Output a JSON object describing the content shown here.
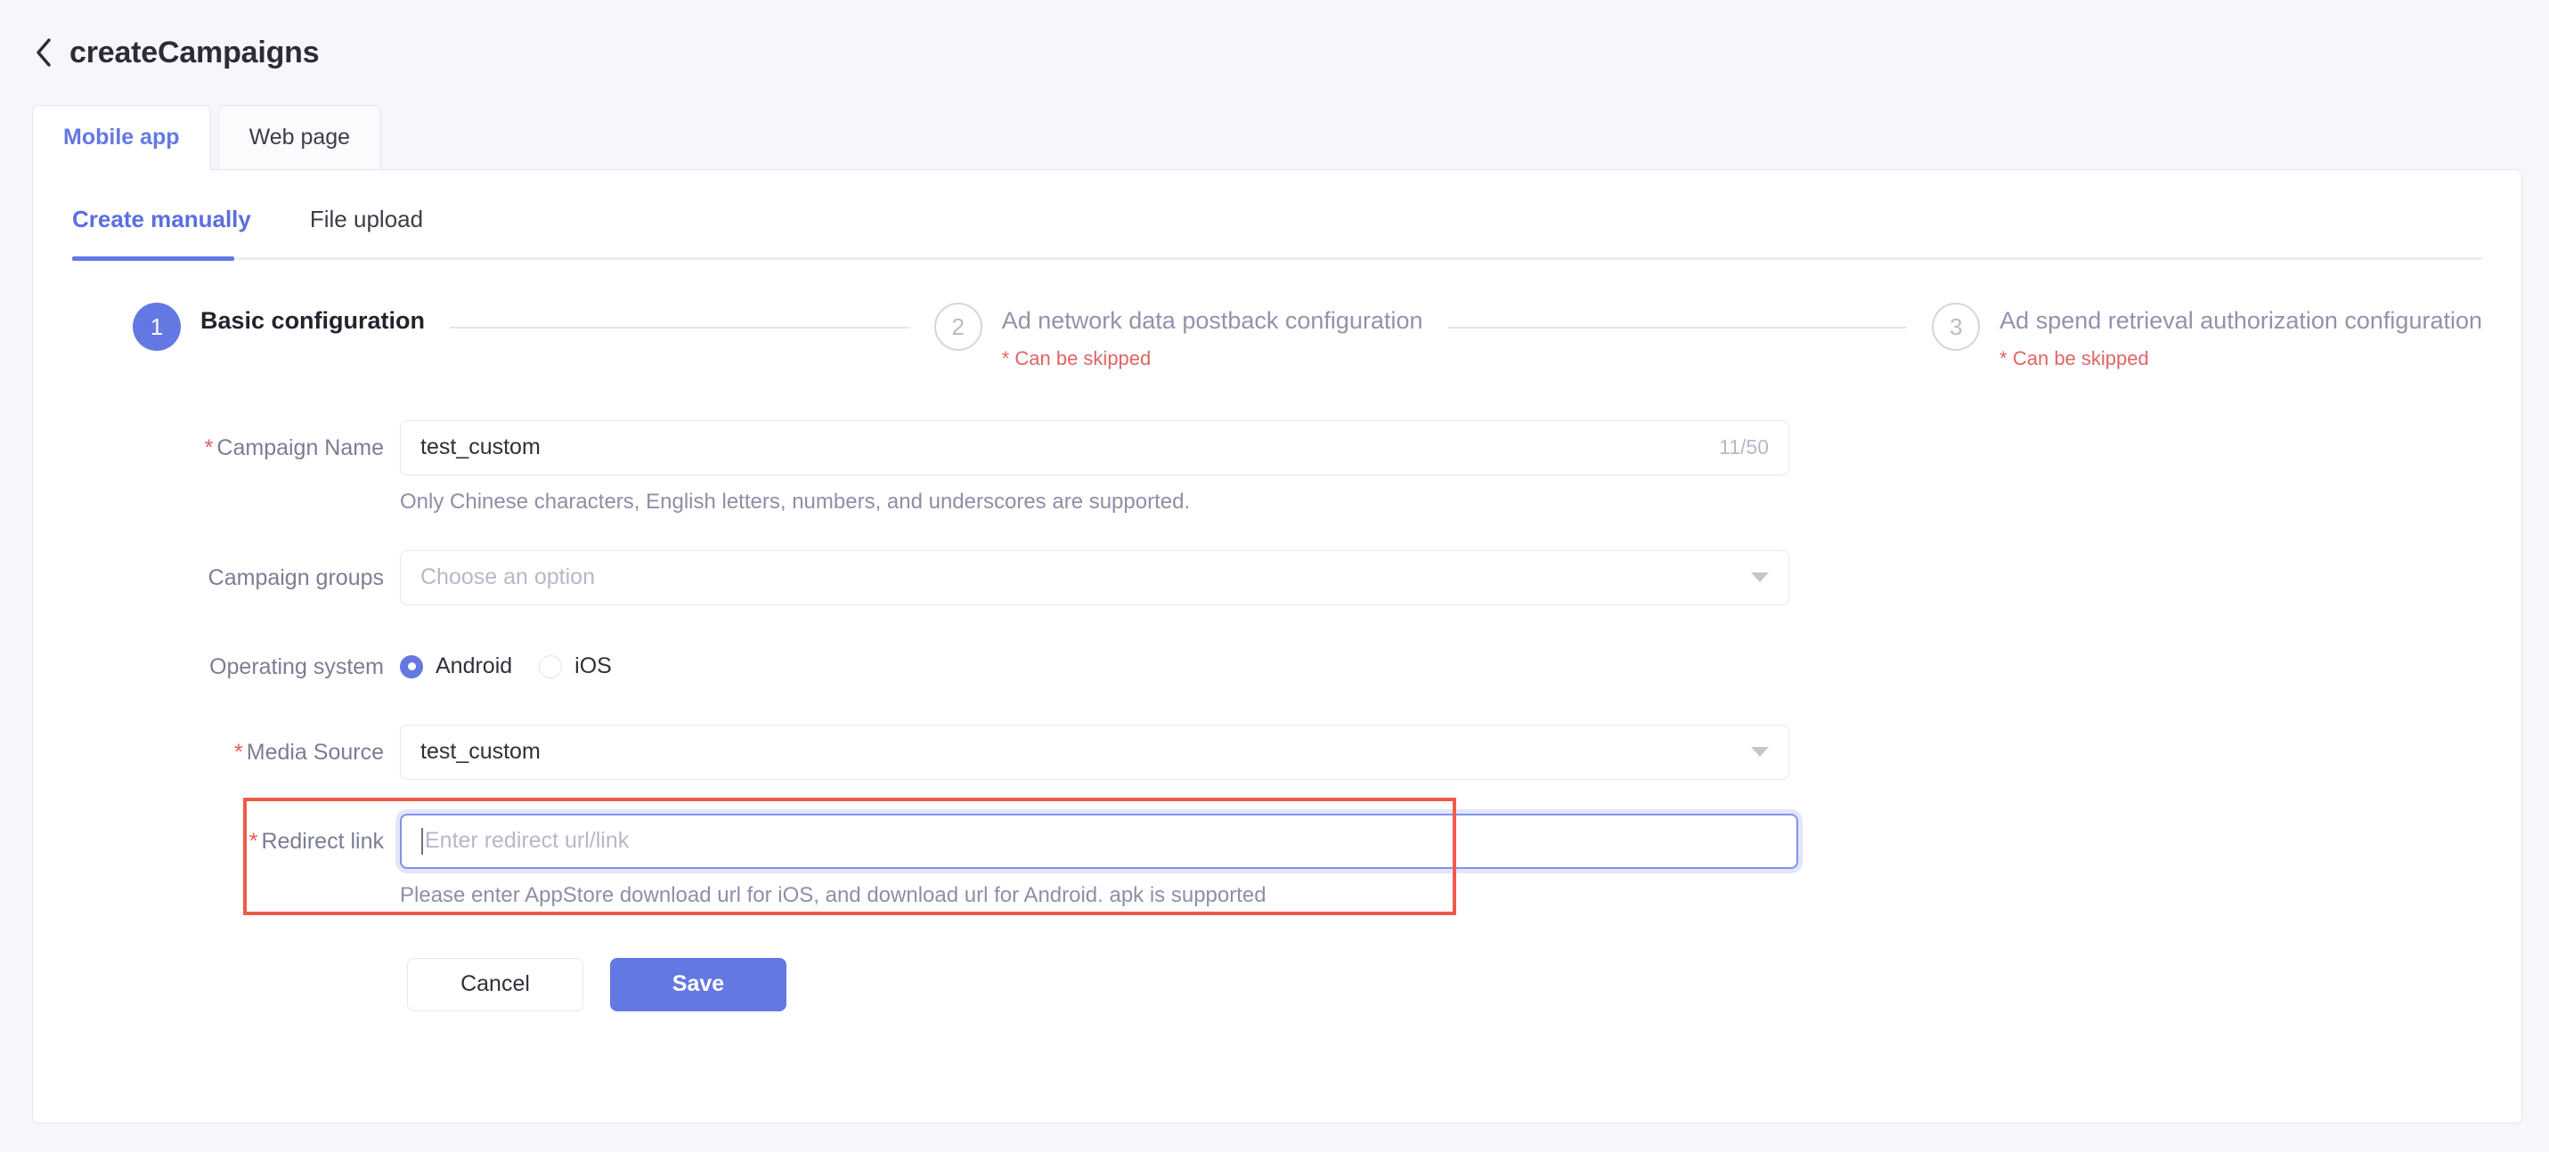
{
  "header": {
    "back_icon": "chevron-left-icon",
    "title": "createCampaigns"
  },
  "tabs": [
    {
      "label": "Mobile app",
      "active": true
    },
    {
      "label": "Web page",
      "active": false
    }
  ],
  "subtabs": [
    {
      "label": "Create manually",
      "active": true
    },
    {
      "label": "File upload",
      "active": false
    }
  ],
  "stepper": {
    "steps": [
      {
        "number": "1",
        "label": "Basic configuration",
        "note": "",
        "state": "current"
      },
      {
        "number": "2",
        "label": "Ad network data postback configuration",
        "note": "* Can be skipped",
        "state": "pending"
      },
      {
        "number": "3",
        "label": "Ad spend retrieval authorization configuration",
        "note": "* Can be skipped",
        "state": "pending"
      }
    ]
  },
  "form": {
    "campaign_name": {
      "label": "Campaign Name",
      "required_mark": "*",
      "value": "test_custom",
      "counter": "11/50",
      "hint": "Only Chinese characters, English letters, numbers, and underscores are supported."
    },
    "campaign_groups": {
      "label": "Campaign groups",
      "placeholder": "Choose an option",
      "value": ""
    },
    "operating_system": {
      "label": "Operating system",
      "options": [
        {
          "label": "Android",
          "checked": true
        },
        {
          "label": "iOS",
          "checked": false
        }
      ]
    },
    "media_source": {
      "label": "Media Source",
      "required_mark": "*",
      "value": "test_custom"
    },
    "redirect_link": {
      "label": "Redirect link",
      "required_mark": "*",
      "placeholder": "Enter redirect url/link",
      "value": "",
      "hint": "Please enter AppStore download url for iOS, and download url for Android. apk is supported",
      "highlighted": true,
      "focused": true
    }
  },
  "actions": {
    "cancel_label": "Cancel",
    "save_label": "Save"
  },
  "colors": {
    "accent": "#6378e2",
    "danger": "#e06464",
    "highlight": "#ef5b47",
    "page_bg": "#f6f6fb",
    "card_bg": "#ffffff",
    "border": "#e3e6f0"
  }
}
